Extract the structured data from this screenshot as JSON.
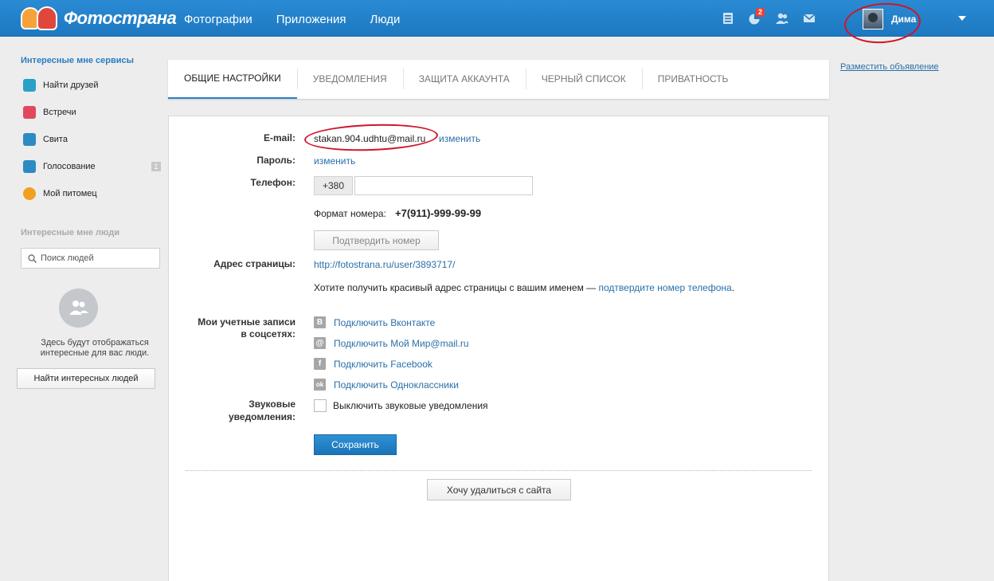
{
  "header": {
    "logo_text": "Фотострана",
    "nav": [
      "Фотографии",
      "Приложения",
      "Люди"
    ],
    "notifications_badge": "2",
    "user_name": "Дима"
  },
  "sidebar": {
    "services_title": "Интересные мне сервисы",
    "items": [
      {
        "label": "Найти друзей",
        "icon": "find-friends-icon",
        "color": "#2aa0c8"
      },
      {
        "label": "Встречи",
        "icon": "meetings-icon",
        "color": "#e2485b"
      },
      {
        "label": "Свита",
        "icon": "crown-icon",
        "color": "#2c8ac4"
      },
      {
        "label": "Голосование",
        "icon": "voting-icon",
        "color": "#2c8ac4",
        "count": "1"
      },
      {
        "label": "Мой питомец",
        "icon": "paw-icon",
        "color": "#f0a020"
      }
    ],
    "people_title": "Интересные мне люди",
    "search_placeholder": "Поиск людей",
    "people_text": "Здесь будут отображаться интересные для вас люди.",
    "people_button": "Найти интересных людей"
  },
  "tabs": [
    {
      "label": "Общие настройки",
      "active": true
    },
    {
      "label": "Уведомления",
      "active": false
    },
    {
      "label": "Защита аккаунта",
      "active": false
    },
    {
      "label": "Черный список",
      "active": false
    },
    {
      "label": "Приватность",
      "active": false
    }
  ],
  "right": {
    "ad_link": "Разместить объявление"
  },
  "form": {
    "email_label": "E-mail:",
    "email_value": "stakan.904.udhtu@mail.ru",
    "change_link": "изменить",
    "password_label": "Пароль:",
    "password_change": "изменить",
    "phone_label": "Телефон:",
    "phone_code": "+380",
    "phone_value": "",
    "format_label": "Формат номера:",
    "format_value": "+7(911)-999-99-99",
    "confirm_button": "Подтвердить номер",
    "address_label": "Адрес страницы:",
    "address_value": "http://fotostrana.ru/user/3893717/",
    "address_hint": "Хотите получить красивый адрес страницы с вашим именем —",
    "address_hint_link": "подтвердите номер телефона",
    "address_hint_end": ".",
    "social_label_1": "Мои учетные записи",
    "social_label_2": "в соцсетях:",
    "social": [
      {
        "label": "Подключить Вконтакте",
        "icon": "vk-icon",
        "glyph": "B"
      },
      {
        "label": "Подключить Мой Мир@mail.ru",
        "icon": "mailru-icon",
        "glyph": "@"
      },
      {
        "label": "Подключить Facebook",
        "icon": "facebook-icon",
        "glyph": "f"
      },
      {
        "label": "Подключить Одноклассники",
        "icon": "odnoklassniki-icon",
        "glyph": "ok"
      }
    ],
    "sound_label_1": "Звуковые",
    "sound_label_2": "уведомления:",
    "sound_checkbox": "Выключить звуковые уведомления",
    "save_button": "Сохранить",
    "delete_button": "Хочу удалиться с сайта"
  }
}
